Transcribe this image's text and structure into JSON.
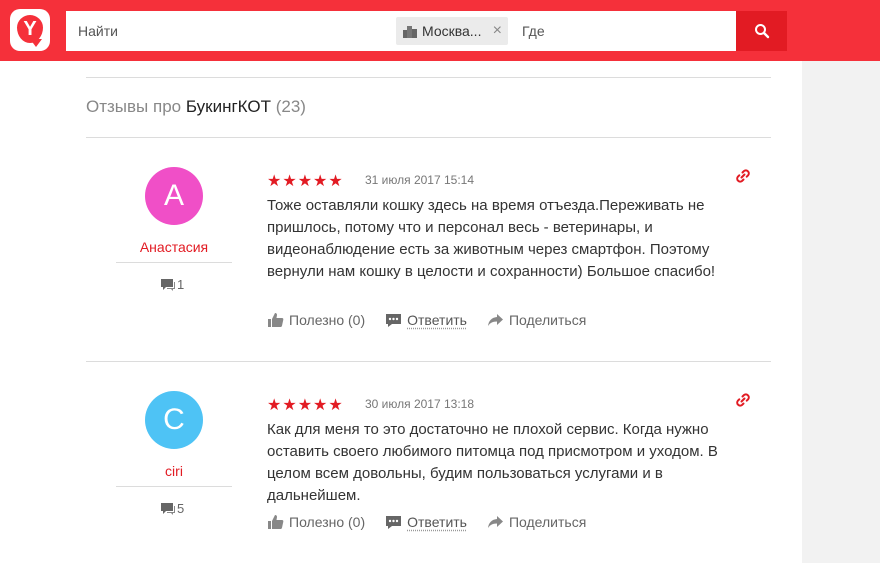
{
  "header": {
    "logo_letter": "Y",
    "search_placeholder": "Найти",
    "city": "Москва...",
    "where_placeholder": "Где"
  },
  "reviews": {
    "title_prefix": "Отзывы про",
    "company": "БукингКОТ",
    "count": "(23)",
    "items": [
      {
        "avatar_letter": "А",
        "avatar_color": "#f04fc7",
        "author": "Анастасия",
        "author_reviews": "1",
        "stars": "★★★★★",
        "date": "31 июля 2017 15:14",
        "text": "Тоже оставляли кошку здесь на время отъезда.Переживать не пришлось, потому что и персонал весь - ветеринары, и видеонаблюдение есть за животным через смартфон. Поэтому вернули нам кошку в целости и сохранности) Большое спасибо!",
        "useful": "Полезно (0)",
        "reply": "Ответить",
        "share": "Поделиться"
      },
      {
        "avatar_letter": "C",
        "avatar_color": "#4ec3f5",
        "author": "ciri",
        "author_reviews": "5",
        "stars": "★★★★★",
        "date": "30 июля 2017 13:18",
        "text": "Как для меня то это достаточно не плохой сервис. Когда нужно оставить своего любимого питомца под присмотром и уходом. В целом всем довольны, будим пользоваться услугами и в дальнейшем.",
        "useful": "Полезно (0)",
        "reply": "Ответить",
        "share": "Поделиться"
      }
    ]
  },
  "colors": {
    "brand": "#f5303a",
    "accent": "#e21b23"
  }
}
